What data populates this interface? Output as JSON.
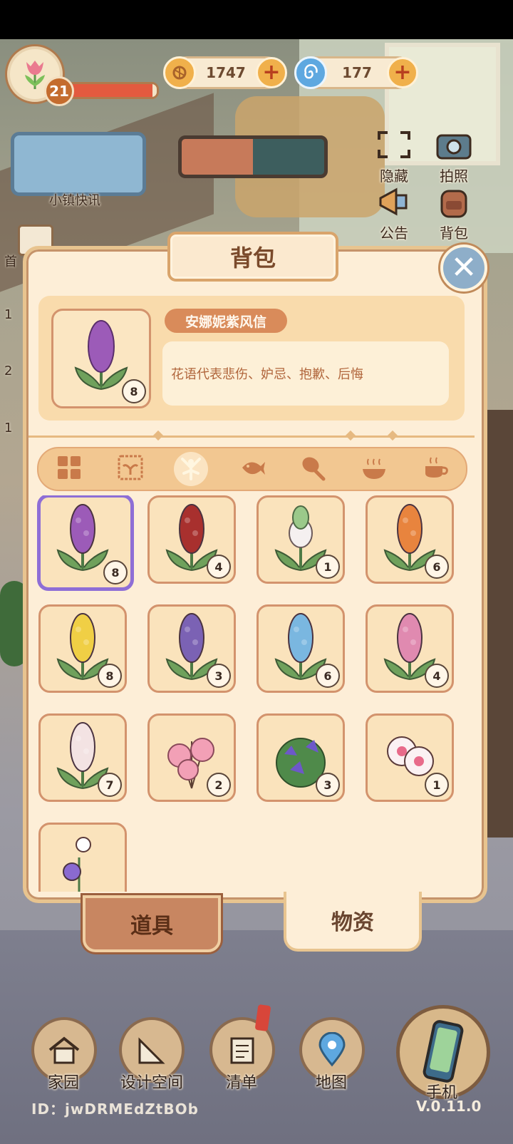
{
  "hud": {
    "level": "21",
    "xp_progress": 0.95,
    "coins": "1747",
    "gems": "177"
  },
  "side": {
    "news_label": "小镇快讯",
    "hide_label": "隐藏",
    "photo_label": "拍照",
    "notice_label": "公告",
    "bag_label": "背包",
    "left_labels": [
      "首",
      "1",
      "2",
      "1"
    ]
  },
  "panel": {
    "title": "背包",
    "selected": {
      "name": "安娜妮紫风信",
      "count": "8",
      "description": "花语代表悲伤、妒忌、抱歉、后悔"
    },
    "categories": [
      {
        "icon": "grid-icon",
        "active": false
      },
      {
        "icon": "seed-packet-icon",
        "active": false
      },
      {
        "icon": "flower-sprout-icon",
        "active": true
      },
      {
        "icon": "fish-icon",
        "active": false
      },
      {
        "icon": "meat-leg-icon",
        "active": false
      },
      {
        "icon": "hot-bowl-icon",
        "active": false
      },
      {
        "icon": "tea-cup-icon",
        "active": false
      }
    ],
    "items": [
      {
        "icon": "purple-hyacinth-icon",
        "count": "8",
        "color": "#9c5bb8",
        "selected": true
      },
      {
        "icon": "red-hyacinth-icon",
        "count": "4",
        "color": "#a8302e",
        "selected": false
      },
      {
        "icon": "green-white-hyacinth-icon",
        "count": "1",
        "color": "#9bc98a",
        "selected": false
      },
      {
        "icon": "orange-hyacinth-icon",
        "count": "6",
        "color": "#e8843e",
        "selected": false
      },
      {
        "icon": "yellow-hyacinth-icon",
        "count": "8",
        "color": "#f0cf45",
        "selected": false
      },
      {
        "icon": "violet-hyacinth-icon",
        "count": "3",
        "color": "#7b62b4",
        "selected": false
      },
      {
        "icon": "blue-hyacinth-icon",
        "count": "6",
        "color": "#7ab7e0",
        "selected": false
      },
      {
        "icon": "pink-hyacinth-icon",
        "count": "4",
        "color": "#e08ab0",
        "selected": false
      },
      {
        "icon": "white-hyacinth-icon",
        "count": "7",
        "color": "#f3e3e3",
        "selected": false
      },
      {
        "icon": "pink-lily-icon",
        "count": "2",
        "color": "#f2a0b6",
        "selected": false
      },
      {
        "icon": "bellflower-icon",
        "count": "3",
        "color": "#6d58c9",
        "selected": false
      },
      {
        "icon": "white-pink-flower-icon",
        "count": "1",
        "color": "#e86a8a",
        "selected": false
      },
      {
        "icon": "small-flower-icon",
        "count": "",
        "color": "#8a6ad0",
        "selected": false
      }
    ],
    "tabs": {
      "tools": "道具",
      "materials": "物资"
    }
  },
  "nav": {
    "home": "家园",
    "design": "设计空间",
    "list": "清单",
    "map": "地图",
    "phone": "手机"
  },
  "footer": {
    "id": "ID：jwDRMEdZtBOb",
    "version": "V.0.11.0"
  }
}
